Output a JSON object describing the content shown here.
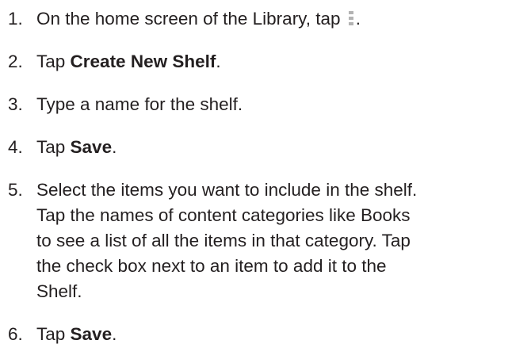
{
  "steps": [
    {
      "number": "1.",
      "text_before": "On the home screen of the Library, tap ",
      "icon": "menu-icon",
      "text_after": "."
    },
    {
      "number": "2.",
      "text_before": "Tap ",
      "bold": "Create New Shelf",
      "text_after": "."
    },
    {
      "number": "3.",
      "text": "Type a name for the shelf."
    },
    {
      "number": "4.",
      "text_before": "Tap ",
      "bold": "Save",
      "text_after": "."
    },
    {
      "number": "5.",
      "lines": [
        "Select the items you want to include in the shelf.",
        "Tap the names of content categories like Books",
        "to see a list of all the items in that category. Tap",
        "the check box next to an item to add it to the",
        "Shelf."
      ]
    },
    {
      "number": "6.",
      "text_before": "Tap ",
      "bold": "Save",
      "text_after": "."
    }
  ],
  "colors": {
    "text": "#231f20",
    "icon": "#b3b3b3"
  }
}
